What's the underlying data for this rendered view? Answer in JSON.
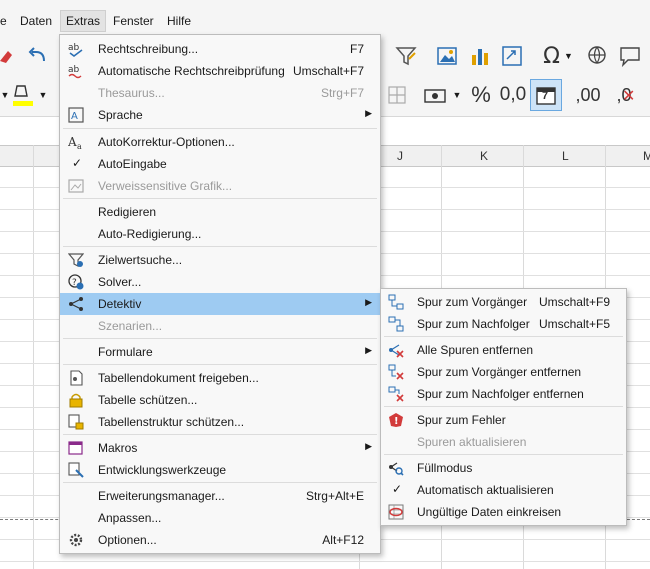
{
  "menubar": {
    "items": [
      {
        "label": "e"
      },
      {
        "label": "Daten"
      },
      {
        "label": "Extras"
      },
      {
        "label": "Fenster"
      },
      {
        "label": "Hilfe"
      }
    ]
  },
  "toolbar": {
    "format_percent": "%",
    "format_number": "0,0",
    "calendar_day": "7",
    "add_decimal": ",00",
    "remove_decimal": ",0"
  },
  "columns": [
    "J",
    "K",
    "L",
    "M"
  ],
  "extras_menu": {
    "items": [
      {
        "label": "Rechtschreibung...",
        "shortcut": "F7"
      },
      {
        "label": "Automatische Rechtschreibprüfung",
        "shortcut": "Umschalt+F7"
      },
      {
        "label": "Thesaurus...",
        "shortcut": "Strg+F7"
      },
      {
        "label": "Sprache"
      },
      {
        "label": "AutoKorrektur-Optionen..."
      },
      {
        "label": "AutoEingabe"
      },
      {
        "label": "Verweissensitive Grafik..."
      },
      {
        "label": "Redigieren"
      },
      {
        "label": "Auto-Redigierung..."
      },
      {
        "label": "Zielwertsuche..."
      },
      {
        "label": "Solver..."
      },
      {
        "label": "Detektiv"
      },
      {
        "label": "Szenarien..."
      },
      {
        "label": "Formulare"
      },
      {
        "label": "Tabellendokument freigeben..."
      },
      {
        "label": "Tabelle schützen..."
      },
      {
        "label": "Tabellenstruktur schützen..."
      },
      {
        "label": "Makros"
      },
      {
        "label": "Entwicklungswerkzeuge"
      },
      {
        "label": "Erweiterungsmanager...",
        "shortcut": "Strg+Alt+E"
      },
      {
        "label": "Anpassen..."
      },
      {
        "label": "Optionen...",
        "shortcut": "Alt+F12"
      }
    ]
  },
  "detektiv_menu": {
    "items": [
      {
        "label": "Spur zum Vorgänger",
        "shortcut": "Umschalt+F9"
      },
      {
        "label": "Spur zum Nachfolger",
        "shortcut": "Umschalt+F5"
      },
      {
        "label": "Alle Spuren entfernen"
      },
      {
        "label": "Spur zum Vorgänger entfernen"
      },
      {
        "label": "Spur zum Nachfolger entfernen"
      },
      {
        "label": "Spur zum Fehler"
      },
      {
        "label": "Spuren aktualisieren"
      },
      {
        "label": "Füllmodus"
      },
      {
        "label": "Automatisch aktualisieren"
      },
      {
        "label": "Ungültige Daten einkreisen"
      }
    ]
  }
}
